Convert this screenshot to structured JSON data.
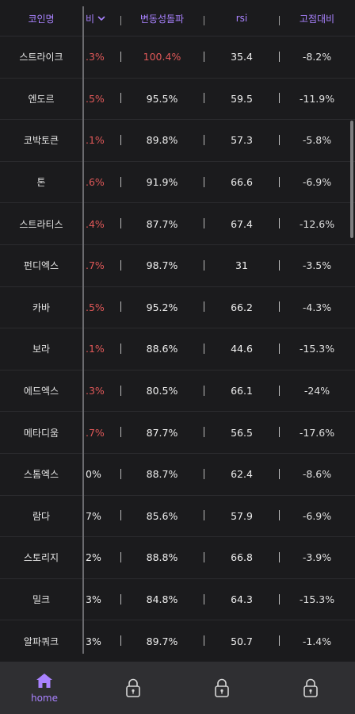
{
  "header": {
    "col_name": "코인명",
    "col_change": "비",
    "col_vb": "변동성돌파",
    "col_rsi": "rsi",
    "col_high": "고점대비"
  },
  "rows": [
    {
      "name": "스트라이크",
      "change": ".3%",
      "vb": "100.4%",
      "rsi": "35.4",
      "high": "-8.2%"
    },
    {
      "name": "엔도르",
      "change": ".5%",
      "vb": "95.5%",
      "rsi": "59.5",
      "high": "-11.9%"
    },
    {
      "name": "코박토큰",
      "change": ".1%",
      "vb": "89.8%",
      "rsi": "57.3",
      "high": "-5.8%"
    },
    {
      "name": "톤",
      "change": ".6%",
      "vb": "91.9%",
      "rsi": "66.6",
      "high": "-6.9%"
    },
    {
      "name": "스트라티스",
      "change": ".4%",
      "vb": "87.7%",
      "rsi": "67.4",
      "high": "-12.6%"
    },
    {
      "name": "펀디엑스",
      "change": ".7%",
      "vb": "98.7%",
      "rsi": "31",
      "high": "-3.5%"
    },
    {
      "name": "카바",
      "change": ".5%",
      "vb": "95.2%",
      "rsi": "66.2",
      "high": "-4.3%"
    },
    {
      "name": "보라",
      "change": ".1%",
      "vb": "88.6%",
      "rsi": "44.6",
      "high": "-15.3%"
    },
    {
      "name": "에드엑스",
      "change": ".3%",
      "vb": "80.5%",
      "rsi": "66.1",
      "high": "-24%"
    },
    {
      "name": "메타디움",
      "change": ".7%",
      "vb": "87.7%",
      "rsi": "56.5",
      "high": "-17.6%"
    },
    {
      "name": "스톰엑스",
      "change": "0%",
      "vb": "88.7%",
      "rsi": "62.4",
      "high": "-8.6%"
    },
    {
      "name": "람다",
      "change": "7%",
      "vb": "85.6%",
      "rsi": "57.9",
      "high": "-6.9%"
    },
    {
      "name": "스토리지",
      "change": "2%",
      "vb": "88.8%",
      "rsi": "66.8",
      "high": "-3.9%"
    },
    {
      "name": "밀크",
      "change": "3%",
      "vb": "84.8%",
      "rsi": "64.3",
      "high": "-15.3%"
    },
    {
      "name": "알파쿼크",
      "change": "3%",
      "vb": "89.7%",
      "rsi": "50.7",
      "high": "-1.4%"
    }
  ],
  "tabs": [
    {
      "label": "home",
      "icon": "home-icon",
      "active": true
    },
    {
      "label": "",
      "icon": "lock-icon",
      "active": false
    },
    {
      "label": "",
      "icon": "lock-icon",
      "active": false
    },
    {
      "label": "",
      "icon": "lock-icon",
      "active": false
    }
  ],
  "colors": {
    "accent": "#a982ff",
    "up": "#e05858",
    "background": "#1b1b1d",
    "tabbar": "#2f2f32"
  }
}
